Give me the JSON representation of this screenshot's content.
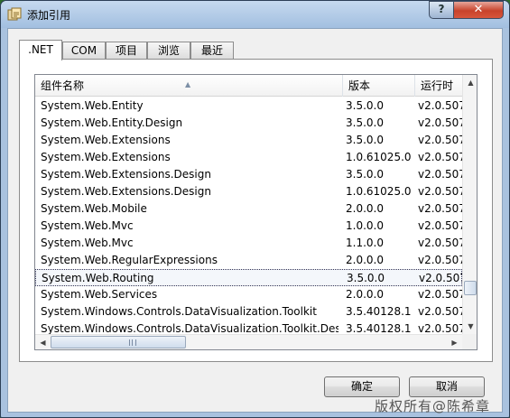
{
  "window": {
    "title": "添加引用",
    "help_label": "?",
    "close_label": "✕",
    "icon": "add-reference-icon"
  },
  "tabs": [
    {
      "label": ".NET",
      "active": true
    },
    {
      "label": "COM",
      "active": false
    },
    {
      "label": "项目",
      "active": false
    },
    {
      "label": "浏览",
      "active": false
    },
    {
      "label": "最近",
      "active": false
    }
  ],
  "list": {
    "columns": [
      "组件名称",
      "版本",
      "运行时"
    ],
    "rows": [
      {
        "name": "System.Web.Entity",
        "version": "3.5.0.0",
        "runtime": "v2.0.507"
      },
      {
        "name": "System.Web.Entity.Design",
        "version": "3.5.0.0",
        "runtime": "v2.0.507"
      },
      {
        "name": "System.Web.Extensions",
        "version": "3.5.0.0",
        "runtime": "v2.0.507"
      },
      {
        "name": "System.Web.Extensions",
        "version": "1.0.61025.0",
        "runtime": "v2.0.507"
      },
      {
        "name": "System.Web.Extensions.Design",
        "version": "3.5.0.0",
        "runtime": "v2.0.507"
      },
      {
        "name": "System.Web.Extensions.Design",
        "version": "1.0.61025.0",
        "runtime": "v2.0.507"
      },
      {
        "name": "System.Web.Mobile",
        "version": "2.0.0.0",
        "runtime": "v2.0.507"
      },
      {
        "name": "System.Web.Mvc",
        "version": "1.0.0.0",
        "runtime": "v2.0.507"
      },
      {
        "name": "System.Web.Mvc",
        "version": "1.1.0.0",
        "runtime": "v2.0.507"
      },
      {
        "name": "System.Web.RegularExpressions",
        "version": "2.0.0.0",
        "runtime": "v2.0.507"
      },
      {
        "name": "System.Web.Routing",
        "version": "3.5.0.0",
        "runtime": "v2.0.507",
        "selected": true
      },
      {
        "name": "System.Web.Services",
        "version": "2.0.0.0",
        "runtime": "v2.0.507"
      },
      {
        "name": "System.Windows.Controls.DataVisualization.Toolkit",
        "version": "3.5.40128.1",
        "runtime": "v2.0.507"
      },
      {
        "name": "System.Windows.Controls.DataVisualization.Toolkit.Design",
        "version": "3.5.40128.1",
        "runtime": "v2.0.507"
      }
    ]
  },
  "buttons": {
    "ok": "确定",
    "cancel": "取消"
  },
  "watermark": "版权所有@陈希章"
}
